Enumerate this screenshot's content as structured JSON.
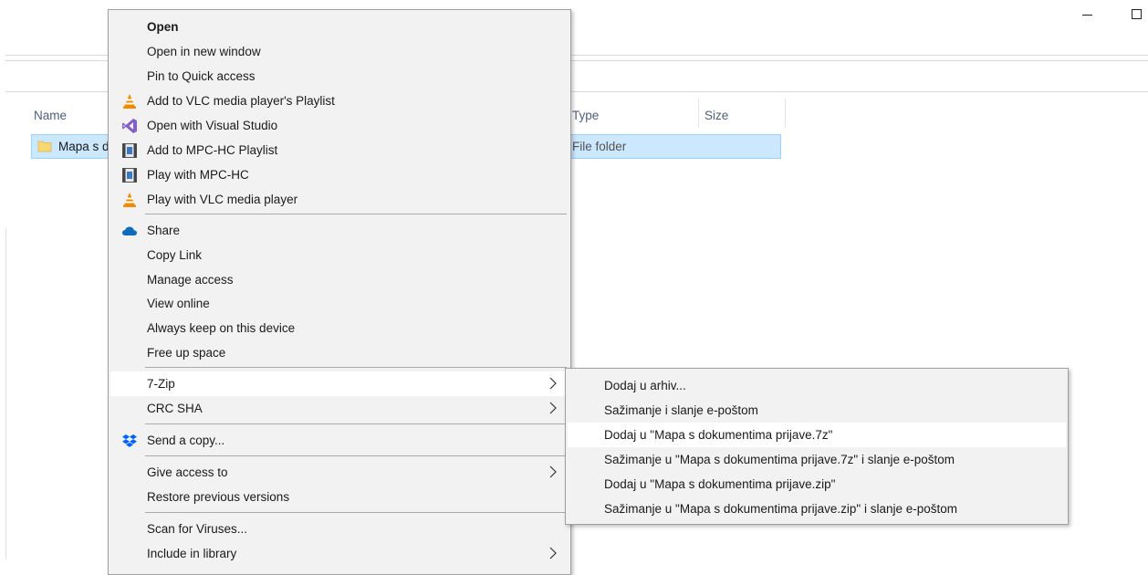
{
  "window": {
    "minimize_icon": "minimize-icon",
    "maximize_icon": "maximize-icon"
  },
  "file_list": {
    "columns": {
      "name": "Name",
      "type": "Type",
      "size": "Size"
    },
    "rows": [
      {
        "name": "Mapa s d",
        "type": "File folder",
        "selected": true,
        "icon": "folder-icon"
      }
    ]
  },
  "context_menu": {
    "groups": [
      [
        {
          "label": "Open",
          "bold": true
        },
        {
          "label": "Open in new window"
        },
        {
          "label": "Pin to Quick access"
        },
        {
          "label": "Add to VLC media player's Playlist",
          "icon": "vlc-icon"
        },
        {
          "label": "Open with Visual Studio",
          "icon": "visual-studio-icon"
        },
        {
          "label": "Add to MPC-HC Playlist",
          "icon": "mpc-hc-icon"
        },
        {
          "label": "Play with MPC-HC",
          "icon": "mpc-hc-icon"
        },
        {
          "label": "Play with VLC media player",
          "icon": "vlc-icon"
        }
      ],
      [
        {
          "label": "Share",
          "icon": "onedrive-cloud-icon"
        },
        {
          "label": "Copy Link"
        },
        {
          "label": "Manage access"
        },
        {
          "label": "View online"
        },
        {
          "label": "Always keep on this device"
        },
        {
          "label": "Free up space"
        }
      ],
      [
        {
          "label": "7-Zip",
          "submenu": true,
          "hover": true
        },
        {
          "label": "CRC SHA",
          "submenu": true
        }
      ],
      [
        {
          "label": "Send a copy...",
          "icon": "dropbox-icon"
        }
      ],
      [
        {
          "label": "Give access to",
          "submenu": true
        },
        {
          "label": "Restore previous versions"
        }
      ],
      [
        {
          "label": "Scan for Viruses..."
        },
        {
          "label": "Include in library",
          "submenu": true
        }
      ]
    ]
  },
  "submenu_7zip": {
    "items": [
      {
        "label": "Dodaj u arhiv..."
      },
      {
        "label": "Sažimanje i slanje e-poštom"
      },
      {
        "label": "Dodaj u \"Mapa s dokumentima prijave.7z\"",
        "hover": true
      },
      {
        "label": "Sažimanje u \"Mapa s dokumentima prijave.7z\" i slanje e-poštom"
      },
      {
        "label": "Dodaj u \"Mapa s dokumentima prijave.zip\""
      },
      {
        "label": "Sažimanje u \"Mapa s dokumentima prijave.zip\" i slanje e-poštom"
      }
    ]
  },
  "colors": {
    "menu_bg": "#f2f2f2",
    "menu_hover": "#ffffff",
    "selection_bg": "#cce8ff",
    "selection_border": "#99d1ff",
    "vlc_orange": "#f08a00",
    "vs_purple": "#865fc5",
    "onedrive_blue": "#0f6cbd",
    "dropbox_blue": "#0061fe",
    "folder_yellow": "#f8d775"
  }
}
